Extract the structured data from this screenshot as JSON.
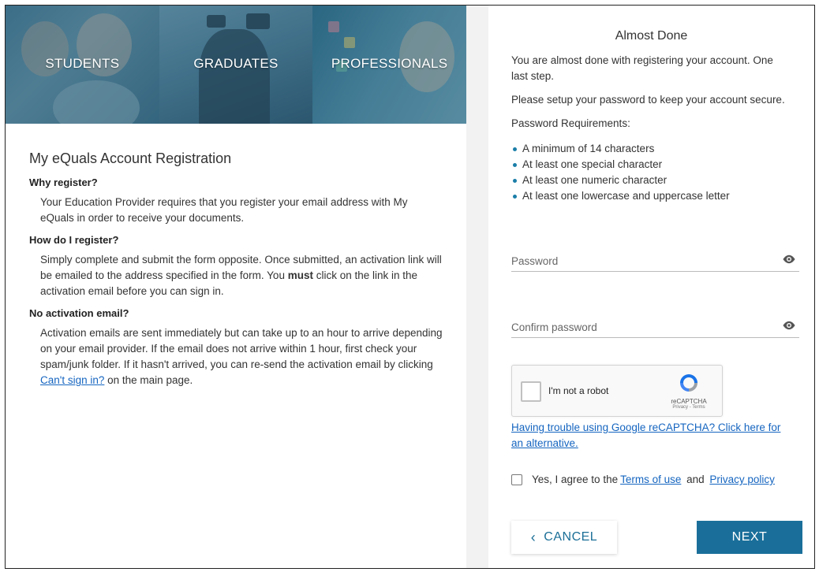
{
  "banner": {
    "panels": [
      "STUDENTS",
      "GRADUATES",
      "PROFESSIONALS"
    ]
  },
  "left": {
    "title": "My eQuals Account Registration",
    "why_heading": "Why register?",
    "why_text": "Your Education Provider requires that you register your email address with My eQuals in order to receive your documents.",
    "how_heading": "How do I register?",
    "how_text_1": "Simply complete and submit the form opposite. Once submitted, an activation link will be emailed to the address specified in the form. You ",
    "how_text_bold": "must",
    "how_text_2": " click on the link in the activation email before you can sign in.",
    "noact_heading": "No activation email?",
    "noact_text_1": "Activation emails are sent immediately but can take up to an hour to arrive depending on your email provider. If the email does not arrive within 1 hour, first check your spam/junk folder. If it hasn't arrived, you can re-send the activation email by clicking ",
    "noact_link": "Can't sign in?",
    "noact_text_2": " on the main page."
  },
  "right": {
    "title": "Almost Done",
    "intro": "You are almost done with registering your account. One last step.",
    "setup": "Please setup your password to keep your account secure.",
    "req_heading": "Password Requirements:",
    "requirements": [
      "A minimum of 14 characters",
      "At least one special character",
      "At least one numeric character",
      "At least one lowercase and uppercase letter"
    ],
    "password_placeholder": "Password",
    "confirm_placeholder": "Confirm password",
    "captcha": {
      "label": "I'm not a robot",
      "brand": "reCAPTCHA",
      "terms": "Privacy - Terms"
    },
    "captcha_help_link": "Having trouble using Google reCAPTCHA? Click here for an alternative.",
    "agree_text_1": "Yes, I agree to the ",
    "agree_terms": "Terms of use",
    "agree_and": " and ",
    "agree_privacy": "Privacy policy",
    "cancel_label": "CANCEL",
    "next_label": "NEXT"
  },
  "colors": {
    "accent": "#1a6f9a",
    "link": "#1565c0"
  }
}
